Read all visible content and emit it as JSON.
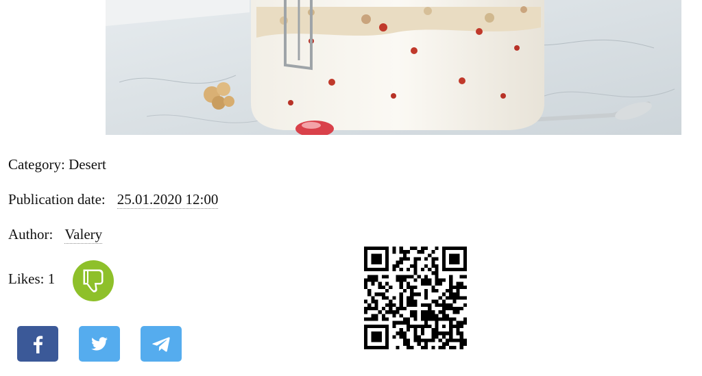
{
  "meta": {
    "category_label": "Category:",
    "category_value": "Desert",
    "date_label": "Publication date:",
    "date_value": "25.01.2020 12:00",
    "author_label": "Author:",
    "author_value": "Valery",
    "likes_label": "Likes:",
    "likes_count": "1"
  },
  "icons": {
    "dislike": "thumbs-down-icon",
    "facebook": "facebook-icon",
    "twitter": "twitter-icon",
    "telegram": "telegram-icon"
  },
  "colors": {
    "dislike_button": "#8ec02a",
    "facebook": "#3b5998",
    "twitter": "#55acee",
    "telegram": "#55acee"
  }
}
